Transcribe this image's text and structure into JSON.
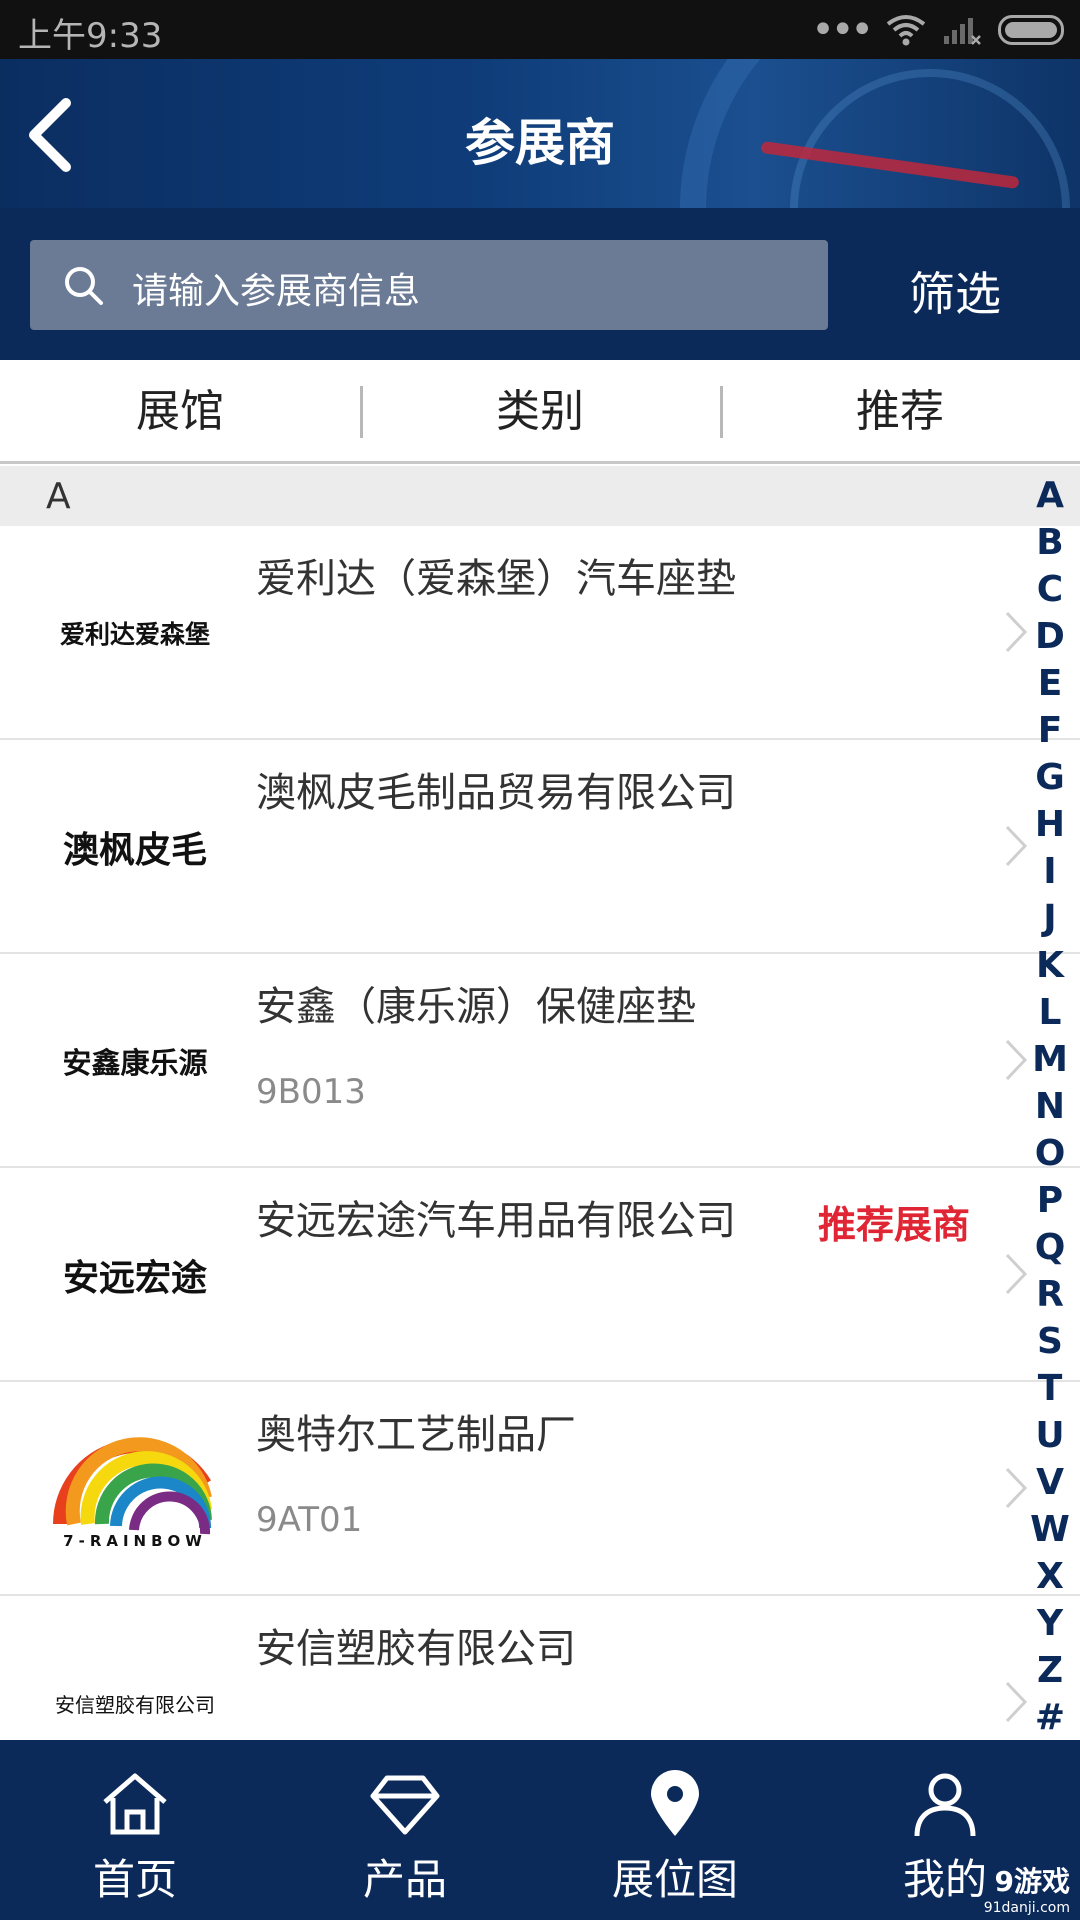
{
  "status_bar": {
    "time": "上午9:33"
  },
  "header": {
    "title": "参展商"
  },
  "search": {
    "placeholder": "请输入参展商信息",
    "filter_label": "筛选"
  },
  "tabs": [
    {
      "label": "展馆"
    },
    {
      "label": "类别"
    },
    {
      "label": "推荐"
    }
  ],
  "section": {
    "letter": "A"
  },
  "exhibitors": [
    {
      "logo_text": "爱利达爱森堡",
      "name": "爱利达（爱森堡）汽车座垫",
      "code": "",
      "badge": ""
    },
    {
      "logo_text": "澳枫皮毛",
      "name": "澳枫皮毛制品贸易有限公司",
      "code": "",
      "badge": ""
    },
    {
      "logo_text": "安鑫康乐源",
      "name": "安鑫（康乐源）保健座垫",
      "code": "9B013",
      "badge": ""
    },
    {
      "logo_text": "安远宏途",
      "name": "安远宏途汽车用品有限公司",
      "code": "",
      "badge": "推荐展商"
    },
    {
      "logo_text": "7-RAINBOW",
      "name": "奥特尔工艺制品厂",
      "code": "9AT01",
      "badge": ""
    },
    {
      "logo_text": "安信塑胶有限公司",
      "name": "安信塑胶有限公司",
      "code": "",
      "badge": ""
    }
  ],
  "alphabet": [
    "A",
    "B",
    "C",
    "D",
    "E",
    "F",
    "G",
    "H",
    "I",
    "J",
    "K",
    "L",
    "M",
    "N",
    "O",
    "P",
    "Q",
    "R",
    "S",
    "T",
    "U",
    "V",
    "W",
    "X",
    "Y",
    "Z",
    "#"
  ],
  "bottom_nav": [
    {
      "label": "首页",
      "icon": "home-icon"
    },
    {
      "label": "产品",
      "icon": "diamond-icon"
    },
    {
      "label": "展位图",
      "icon": "map-pin-icon"
    },
    {
      "label": "我的",
      "icon": "user-icon"
    }
  ],
  "watermark": {
    "brand": "9游戏",
    "url": "91danji.com"
  },
  "colors": {
    "navy": "#0b2a5a",
    "badge_red": "#e02634",
    "search_bg": "#6b7b95"
  }
}
